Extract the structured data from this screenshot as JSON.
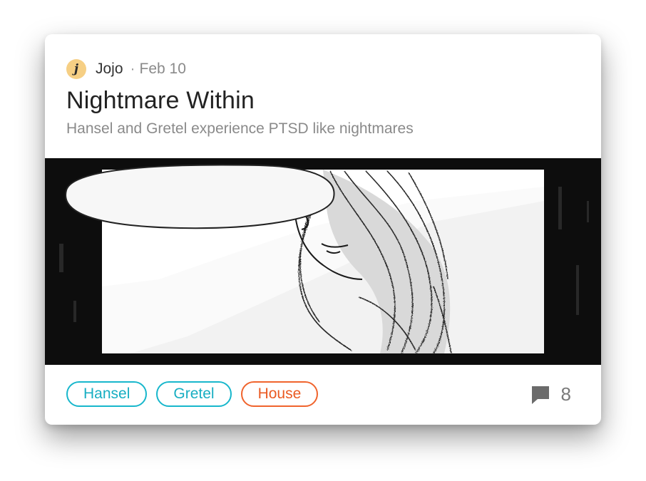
{
  "post": {
    "author": {
      "initial": "j",
      "name": "Jojo",
      "avatar_color": "#f6cf84"
    },
    "separator": "·",
    "date": "Feb 10",
    "title": "Nightmare Within",
    "subtitle": "Hansel and Gretel experience PTSD like nightmares",
    "cover_image": "manga-panel-girl-sketch",
    "tags": [
      {
        "label": "Hansel",
        "color": "#18b7cc"
      },
      {
        "label": "Gretel",
        "color": "#18b7cc"
      },
      {
        "label": "House",
        "color": "#f0642d"
      }
    ],
    "comments": {
      "icon": "comment-icon",
      "count": "8"
    }
  }
}
